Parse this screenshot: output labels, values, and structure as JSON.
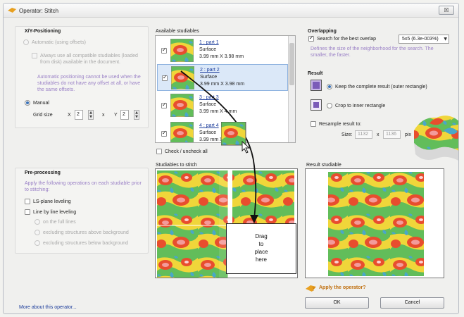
{
  "window": {
    "title": "Operator: Stitch",
    "close_label": "☒"
  },
  "xy": {
    "title": "X/Y-Positioning",
    "automatic_label": "Automatic (using offsets)",
    "always_use_label": "Always use all compatible studiables (loaded from disk) available in the document.",
    "warning": "Automatic positioning cannot be used when the studiables do not have any offset at all, or have the same offsets.",
    "manual_label": "Manual",
    "grid_size_label": "Grid size",
    "x_label": "X",
    "x_value": "2",
    "times": "x",
    "y_label": "Y",
    "y_value": "2"
  },
  "preprocessing": {
    "title": "Pre-processing",
    "hint": "Apply the following operations on each studiable prior to stitching:",
    "ls_plane": "LS-plane leveling",
    "line_by_line": "Line by line leveling",
    "options": [
      "on the full lines",
      "excluding structures above background",
      "excluding structures below background"
    ]
  },
  "studiables": {
    "title": "Available studiables",
    "items": [
      {
        "name": "1 : part 1",
        "type": "Surface",
        "size": "3.99 mm X 3.98 mm",
        "checked": true
      },
      {
        "name": "2 : part 2",
        "type": "Surface",
        "size": "3.99 mm X 3.98 mm",
        "checked": true
      },
      {
        "name": "3 : part 3",
        "type": "Surface",
        "size": "3.99 mm X 4 mm",
        "checked": true
      },
      {
        "name": "4 : part 4",
        "type": "Surface",
        "size": "3.99 mm X 3",
        "checked": true
      }
    ],
    "check_all_label": "Check / uncheck all"
  },
  "overlapping": {
    "title": "Overlapping",
    "search_label": "Search for the best overlap",
    "select_value": "5x5 (6.3e-003%)",
    "hint": "Defines the size of the neighborhood for the search. The smaller, the faster."
  },
  "result": {
    "title": "Result",
    "keep_label": "Keep the complete result (outer rectangle)",
    "crop_label": "Crop to inner rectangle",
    "resample_label": "Resample result to:",
    "size_label": "Size:",
    "size_w": "1132",
    "size_x": "x",
    "size_h": "1136",
    "size_unit": "pix"
  },
  "stitch": {
    "title": "Studiables to stitch",
    "drag_lines": [
      "Drag",
      "to",
      "place",
      "here"
    ]
  },
  "result_panel": {
    "title": "Result studiable"
  },
  "footer": {
    "apply_label": "Apply the operator?",
    "ok_label": "OK",
    "cancel_label": "Cancel",
    "more_link": "More about this operator..."
  },
  "colors": {
    "accent": "#3a72b8",
    "purple_hint": "#9a80c6",
    "link": "#1a3b9a"
  }
}
